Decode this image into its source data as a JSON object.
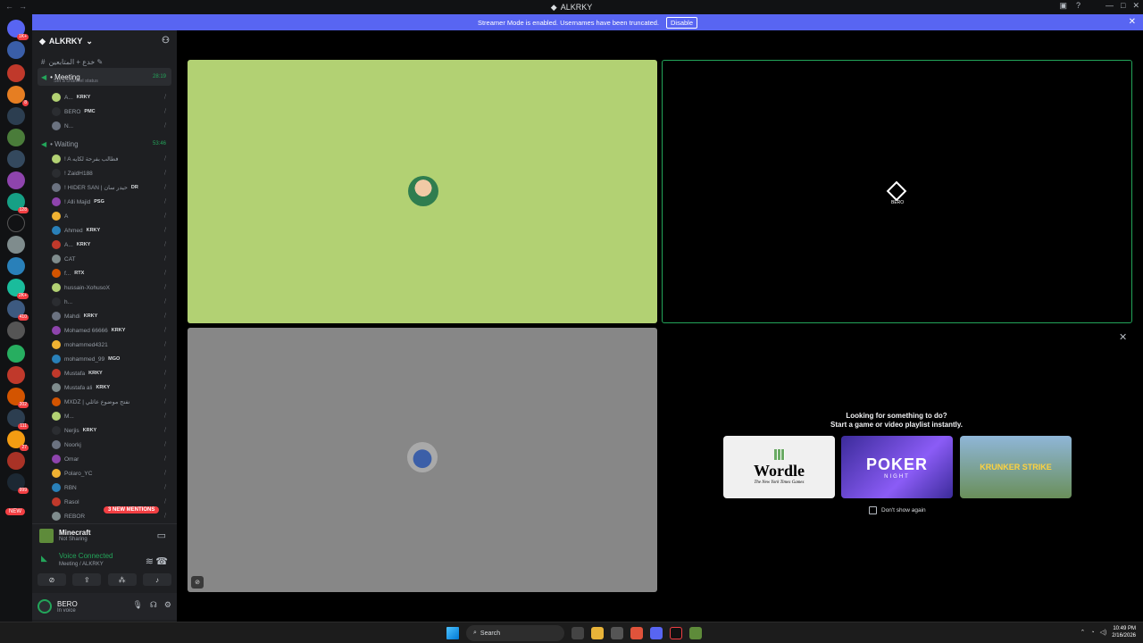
{
  "window": {
    "title": "ALKRKY"
  },
  "streamer": {
    "text": "Streamer Mode is enabled. Usernames have been truncated.",
    "button": "Disable"
  },
  "guild": {
    "name": "ALKRKY"
  },
  "channels": [
    {
      "label": "خدع + المتابعين ✎",
      "kind": "text"
    },
    {
      "label": "• Meeting",
      "kind": "voice",
      "time": "28:19",
      "status": "Set a channel status"
    },
    {
      "label": "• Waiting",
      "kind": "voice",
      "time": "53:46"
    }
  ],
  "meeting_members": [
    {
      "name": "A...",
      "tag": "KRKY"
    },
    {
      "name": "BERO",
      "tag": "PMC"
    },
    {
      "name": "N...",
      "tag": ""
    }
  ],
  "waiting_members": [
    {
      "name": "! A فطالب بفرحة لكايه",
      "tag": ""
    },
    {
      "name": "! ZaidH188",
      "tag": ""
    },
    {
      "name": "! HIDER SAN | حيدر سان",
      "tag": "DR"
    },
    {
      "name": "! Alli Majid",
      "tag": "PSG"
    },
    {
      "name": "A",
      "tag": ""
    },
    {
      "name": "Ahmed",
      "tag": "KRKY"
    },
    {
      "name": "A...",
      "tag": "KRKY"
    },
    {
      "name": "CAT",
      "tag": ""
    },
    {
      "name": "f...",
      "tag": "RTX"
    },
    {
      "name": "hussain-XohusoX",
      "tag": ""
    },
    {
      "name": "h...",
      "tag": ""
    },
    {
      "name": "Mahdi",
      "tag": "KRKY"
    },
    {
      "name": "Mohamed 66666",
      "tag": "KRKY"
    },
    {
      "name": "mohammed4321",
      "tag": ""
    },
    {
      "name": "mohammed_99",
      "tag": "MGO"
    },
    {
      "name": "Mustafa",
      "tag": "KRKY"
    },
    {
      "name": "Mustafa ali",
      "tag": "KRKY"
    },
    {
      "name": "MXDZ | نفتح موضوع عائلي",
      "tag": ""
    },
    {
      "name": "M...",
      "tag": ""
    },
    {
      "name": "Nerjis",
      "tag": "KRKY"
    },
    {
      "name": "Noorkj",
      "tag": ""
    },
    {
      "name": "Omar",
      "tag": ""
    },
    {
      "name": "Polaro_YC",
      "tag": ""
    },
    {
      "name": "RBN",
      "tag": ""
    },
    {
      "name": "Rasol",
      "tag": ""
    },
    {
      "name": "REBOR",
      "tag": ""
    }
  ],
  "mentions_pill": "3 NEW MENTIONS",
  "rail": {
    "new_label": "NEW"
  },
  "activity": {
    "name": "Minecraft",
    "status": "Not Sharing"
  },
  "voice": {
    "status": "Voice Connected",
    "location": "Meeting / ALKRKY"
  },
  "user": {
    "name": "BERO",
    "status": "In voice"
  },
  "tiles": {
    "bero_label": "BERO"
  },
  "suggest": {
    "title_line1": "Looking for something to do?",
    "title_line2": "Start a game or video playlist instantly.",
    "cards": [
      {
        "title": "Wordle",
        "subtitle": "The New York Times Games"
      },
      {
        "title": "POKER",
        "subtitle": "NIGHT"
      },
      {
        "title": "KRUNKER STRIKE",
        "subtitle": ""
      }
    ],
    "dont_show": "Don't show again"
  },
  "taskbar": {
    "search": "Search",
    "time": "10:49 PM",
    "date": "2/16/2026"
  },
  "colors": {
    "accent": "#5865f2",
    "green": "#23a55a",
    "tile1": "#b2d173",
    "tile3": "#878787"
  }
}
